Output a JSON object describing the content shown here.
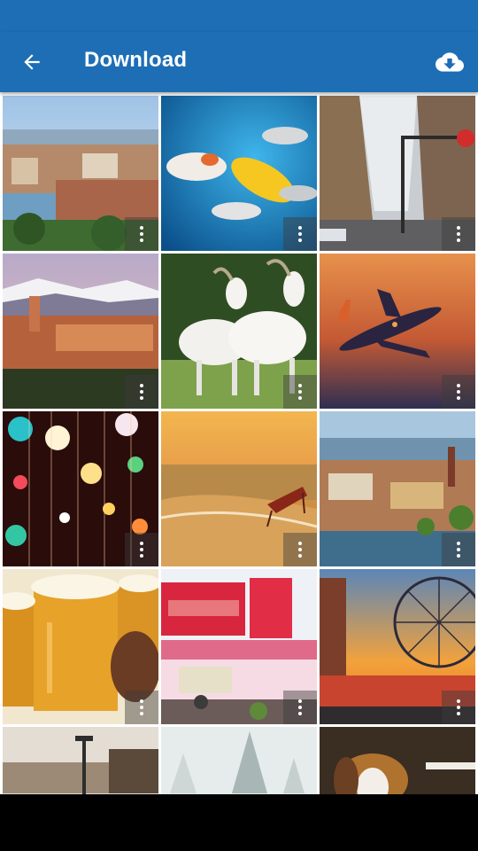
{
  "appbar": {
    "title": "Download",
    "back_icon": "arrow-left-icon",
    "download_icon": "cloud-download-icon",
    "color": "#1d6eb5"
  },
  "grid": {
    "more_icon": "more-vertical-icon",
    "items": [
      {
        "id": "city-skyline"
      },
      {
        "id": "tropical-fish"
      },
      {
        "id": "city-street"
      },
      {
        "id": "castle-mountains"
      },
      {
        "id": "white-goats"
      },
      {
        "id": "airplane-sunset"
      },
      {
        "id": "bokeh-lights"
      },
      {
        "id": "beach-sunset"
      },
      {
        "id": "harbor-city"
      },
      {
        "id": "beer-mugs"
      },
      {
        "id": "fried-dough-stand"
      },
      {
        "id": "ferris-wheel"
      },
      {
        "id": "street-lamp"
      },
      {
        "id": "foggy-trees"
      },
      {
        "id": "beagle-dog"
      }
    ]
  }
}
